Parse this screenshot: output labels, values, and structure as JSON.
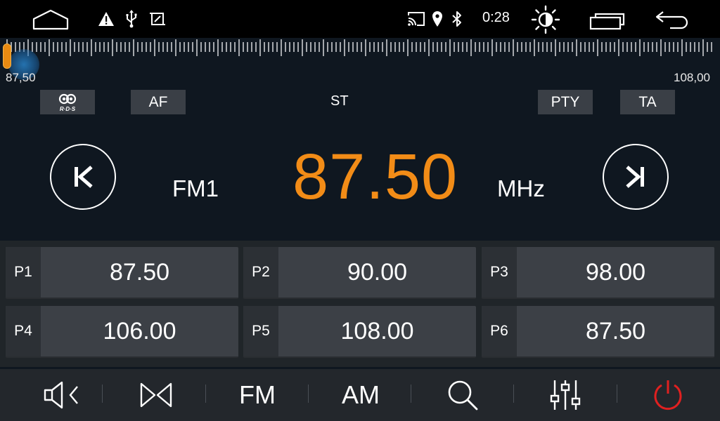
{
  "status_bar": {
    "icons": [
      "home-icon",
      "warning-icon",
      "usb-icon",
      "screenshot-icon",
      "cast-icon",
      "location-icon",
      "bluetooth-icon",
      "brightness-icon",
      "recent-apps-icon",
      "back-icon"
    ],
    "clock": "0:28"
  },
  "tuner": {
    "scale_min_label": "87,50",
    "scale_max_label": "108,00",
    "scale_min": 87.5,
    "scale_max": 108.0,
    "needle_value": 87.5
  },
  "mode_chips": {
    "rds_icon": "rds-icon",
    "af_label": "AF",
    "st_label": "ST",
    "pty_label": "PTY",
    "ta_label": "TA"
  },
  "display": {
    "band": "FM1",
    "frequency": "87.50",
    "unit": "MHz",
    "prev_icon": "seek-previous-icon",
    "next_icon": "seek-next-icon"
  },
  "presets": [
    {
      "label": "P1",
      "value": "87.50"
    },
    {
      "label": "P2",
      "value": "90.00"
    },
    {
      "label": "P3",
      "value": "98.00"
    },
    {
      "label": "P4",
      "value": "106.00"
    },
    {
      "label": "P5",
      "value": "108.00"
    },
    {
      "label": "P6",
      "value": "87.50"
    }
  ],
  "toolbar": {
    "mute_icon": "mute-icon",
    "stereo_icon": "stereo-icon",
    "fm_label": "FM",
    "am_label": "AM",
    "search_icon": "search-icon",
    "eq_icon": "equalizer-icon",
    "power_icon": "power-icon"
  },
  "colors": {
    "accent": "#f28c17",
    "power": "#e02020",
    "chip_bg": "#3a3f46"
  }
}
